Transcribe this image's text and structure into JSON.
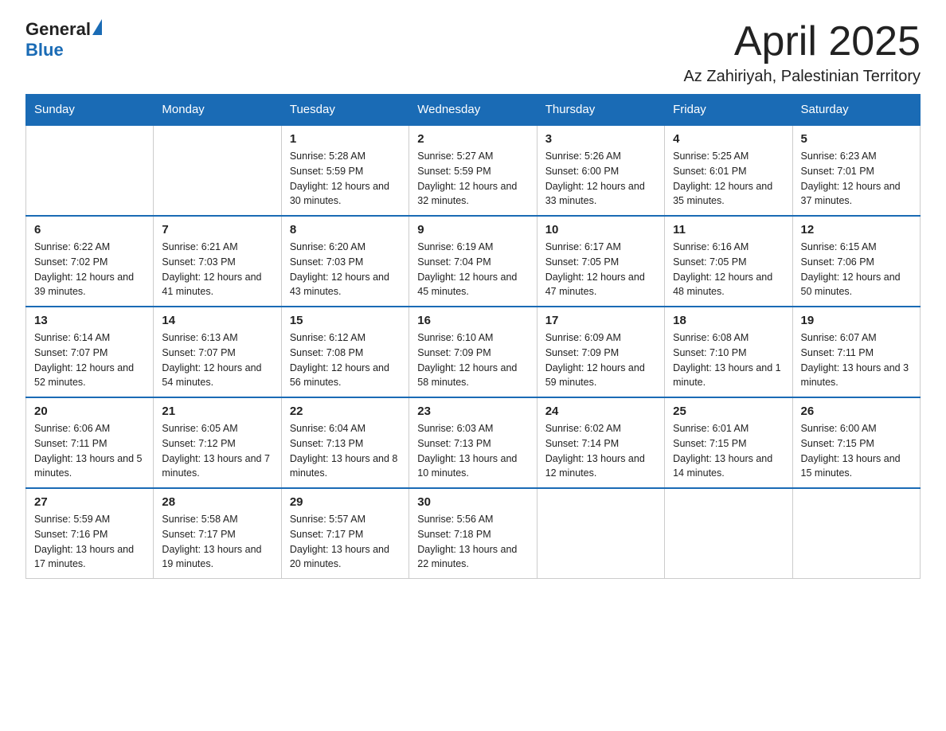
{
  "header": {
    "logo_general": "General",
    "logo_blue": "Blue",
    "month_title": "April 2025",
    "location": "Az Zahiriyah, Palestinian Territory"
  },
  "weekdays": [
    "Sunday",
    "Monday",
    "Tuesday",
    "Wednesday",
    "Thursday",
    "Friday",
    "Saturday"
  ],
  "weeks": [
    [
      {
        "day": "",
        "sunrise": "",
        "sunset": "",
        "daylight": ""
      },
      {
        "day": "",
        "sunrise": "",
        "sunset": "",
        "daylight": ""
      },
      {
        "day": "1",
        "sunrise": "Sunrise: 5:28 AM",
        "sunset": "Sunset: 5:59 PM",
        "daylight": "Daylight: 12 hours and 30 minutes."
      },
      {
        "day": "2",
        "sunrise": "Sunrise: 5:27 AM",
        "sunset": "Sunset: 5:59 PM",
        "daylight": "Daylight: 12 hours and 32 minutes."
      },
      {
        "day": "3",
        "sunrise": "Sunrise: 5:26 AM",
        "sunset": "Sunset: 6:00 PM",
        "daylight": "Daylight: 12 hours and 33 minutes."
      },
      {
        "day": "4",
        "sunrise": "Sunrise: 5:25 AM",
        "sunset": "Sunset: 6:01 PM",
        "daylight": "Daylight: 12 hours and 35 minutes."
      },
      {
        "day": "5",
        "sunrise": "Sunrise: 6:23 AM",
        "sunset": "Sunset: 7:01 PM",
        "daylight": "Daylight: 12 hours and 37 minutes."
      }
    ],
    [
      {
        "day": "6",
        "sunrise": "Sunrise: 6:22 AM",
        "sunset": "Sunset: 7:02 PM",
        "daylight": "Daylight: 12 hours and 39 minutes."
      },
      {
        "day": "7",
        "sunrise": "Sunrise: 6:21 AM",
        "sunset": "Sunset: 7:03 PM",
        "daylight": "Daylight: 12 hours and 41 minutes."
      },
      {
        "day": "8",
        "sunrise": "Sunrise: 6:20 AM",
        "sunset": "Sunset: 7:03 PM",
        "daylight": "Daylight: 12 hours and 43 minutes."
      },
      {
        "day": "9",
        "sunrise": "Sunrise: 6:19 AM",
        "sunset": "Sunset: 7:04 PM",
        "daylight": "Daylight: 12 hours and 45 minutes."
      },
      {
        "day": "10",
        "sunrise": "Sunrise: 6:17 AM",
        "sunset": "Sunset: 7:05 PM",
        "daylight": "Daylight: 12 hours and 47 minutes."
      },
      {
        "day": "11",
        "sunrise": "Sunrise: 6:16 AM",
        "sunset": "Sunset: 7:05 PM",
        "daylight": "Daylight: 12 hours and 48 minutes."
      },
      {
        "day": "12",
        "sunrise": "Sunrise: 6:15 AM",
        "sunset": "Sunset: 7:06 PM",
        "daylight": "Daylight: 12 hours and 50 minutes."
      }
    ],
    [
      {
        "day": "13",
        "sunrise": "Sunrise: 6:14 AM",
        "sunset": "Sunset: 7:07 PM",
        "daylight": "Daylight: 12 hours and 52 minutes."
      },
      {
        "day": "14",
        "sunrise": "Sunrise: 6:13 AM",
        "sunset": "Sunset: 7:07 PM",
        "daylight": "Daylight: 12 hours and 54 minutes."
      },
      {
        "day": "15",
        "sunrise": "Sunrise: 6:12 AM",
        "sunset": "Sunset: 7:08 PM",
        "daylight": "Daylight: 12 hours and 56 minutes."
      },
      {
        "day": "16",
        "sunrise": "Sunrise: 6:10 AM",
        "sunset": "Sunset: 7:09 PM",
        "daylight": "Daylight: 12 hours and 58 minutes."
      },
      {
        "day": "17",
        "sunrise": "Sunrise: 6:09 AM",
        "sunset": "Sunset: 7:09 PM",
        "daylight": "Daylight: 12 hours and 59 minutes."
      },
      {
        "day": "18",
        "sunrise": "Sunrise: 6:08 AM",
        "sunset": "Sunset: 7:10 PM",
        "daylight": "Daylight: 13 hours and 1 minute."
      },
      {
        "day": "19",
        "sunrise": "Sunrise: 6:07 AM",
        "sunset": "Sunset: 7:11 PM",
        "daylight": "Daylight: 13 hours and 3 minutes."
      }
    ],
    [
      {
        "day": "20",
        "sunrise": "Sunrise: 6:06 AM",
        "sunset": "Sunset: 7:11 PM",
        "daylight": "Daylight: 13 hours and 5 minutes."
      },
      {
        "day": "21",
        "sunrise": "Sunrise: 6:05 AM",
        "sunset": "Sunset: 7:12 PM",
        "daylight": "Daylight: 13 hours and 7 minutes."
      },
      {
        "day": "22",
        "sunrise": "Sunrise: 6:04 AM",
        "sunset": "Sunset: 7:13 PM",
        "daylight": "Daylight: 13 hours and 8 minutes."
      },
      {
        "day": "23",
        "sunrise": "Sunrise: 6:03 AM",
        "sunset": "Sunset: 7:13 PM",
        "daylight": "Daylight: 13 hours and 10 minutes."
      },
      {
        "day": "24",
        "sunrise": "Sunrise: 6:02 AM",
        "sunset": "Sunset: 7:14 PM",
        "daylight": "Daylight: 13 hours and 12 minutes."
      },
      {
        "day": "25",
        "sunrise": "Sunrise: 6:01 AM",
        "sunset": "Sunset: 7:15 PM",
        "daylight": "Daylight: 13 hours and 14 minutes."
      },
      {
        "day": "26",
        "sunrise": "Sunrise: 6:00 AM",
        "sunset": "Sunset: 7:15 PM",
        "daylight": "Daylight: 13 hours and 15 minutes."
      }
    ],
    [
      {
        "day": "27",
        "sunrise": "Sunrise: 5:59 AM",
        "sunset": "Sunset: 7:16 PM",
        "daylight": "Daylight: 13 hours and 17 minutes."
      },
      {
        "day": "28",
        "sunrise": "Sunrise: 5:58 AM",
        "sunset": "Sunset: 7:17 PM",
        "daylight": "Daylight: 13 hours and 19 minutes."
      },
      {
        "day": "29",
        "sunrise": "Sunrise: 5:57 AM",
        "sunset": "Sunset: 7:17 PM",
        "daylight": "Daylight: 13 hours and 20 minutes."
      },
      {
        "day": "30",
        "sunrise": "Sunrise: 5:56 AM",
        "sunset": "Sunset: 7:18 PM",
        "daylight": "Daylight: 13 hours and 22 minutes."
      },
      {
        "day": "",
        "sunrise": "",
        "sunset": "",
        "daylight": ""
      },
      {
        "day": "",
        "sunrise": "",
        "sunset": "",
        "daylight": ""
      },
      {
        "day": "",
        "sunrise": "",
        "sunset": "",
        "daylight": ""
      }
    ]
  ]
}
